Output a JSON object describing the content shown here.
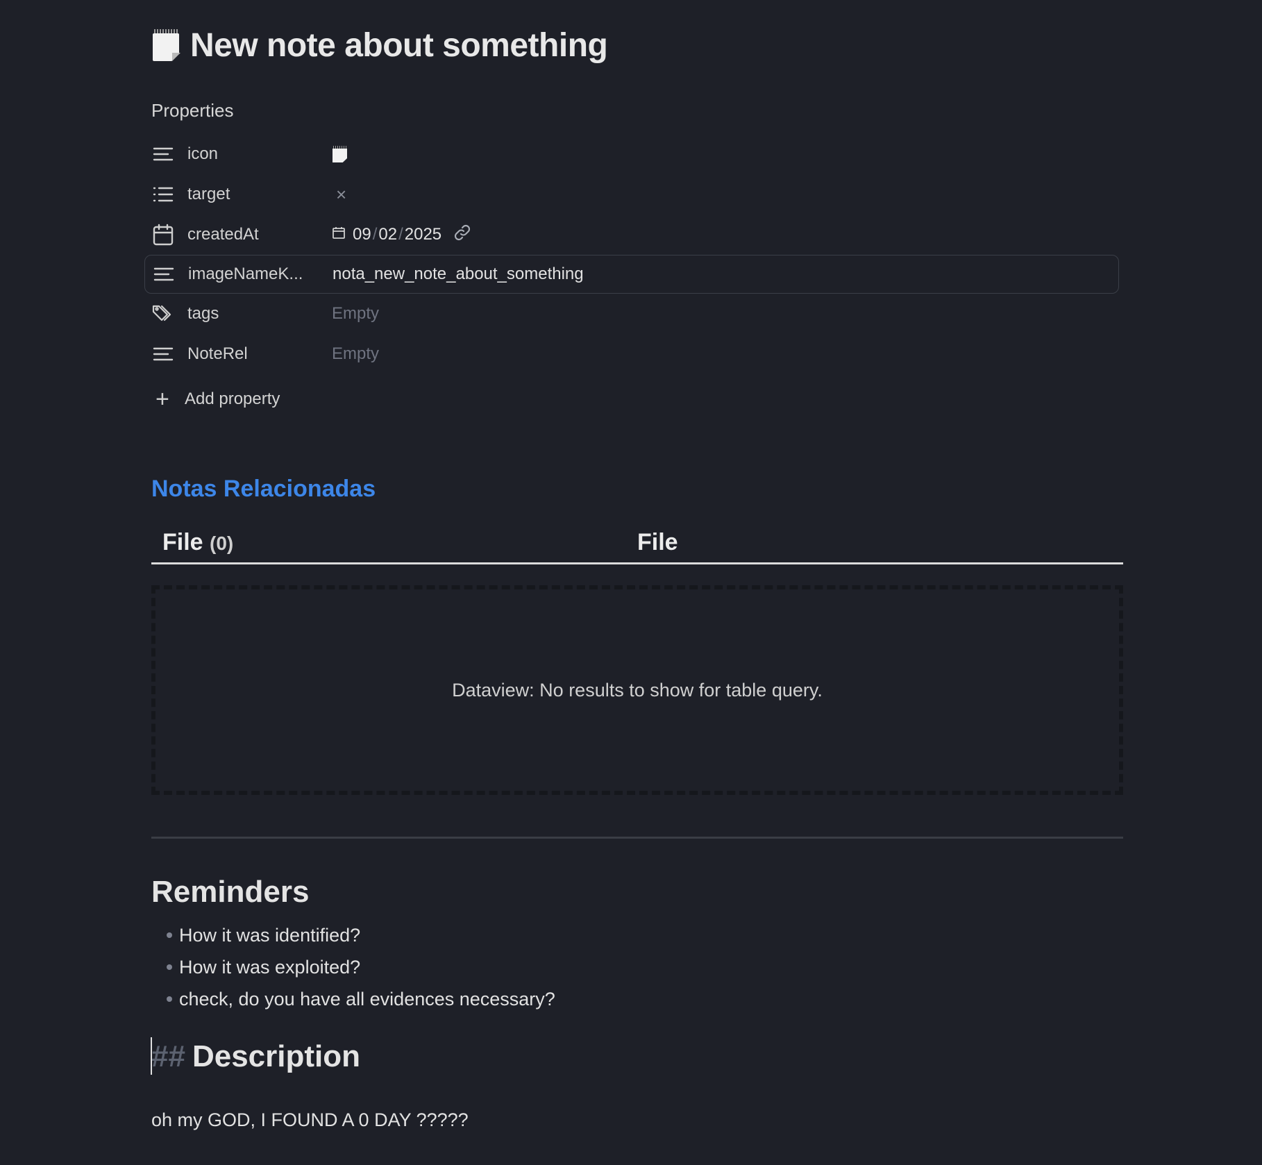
{
  "note": {
    "title": "New note about something",
    "icon": "spiral-notepad-icon"
  },
  "properties": {
    "heading": "Properties",
    "rows": [
      {
        "key": "icon",
        "type_icon": "text-lines-icon",
        "value_icon": "spiral-notepad-icon"
      },
      {
        "key": "target",
        "type_icon": "list-icon",
        "value_icon": "close-icon",
        "value": "×"
      },
      {
        "key": "createdAt",
        "type_icon": "calendar-icon",
        "date": {
          "month": "09",
          "day": "02",
          "year": "2025",
          "sep": "/"
        },
        "value_icon": "link-icon"
      },
      {
        "key": "imageNameK...",
        "type_icon": "text-lines-icon",
        "value": "nota_new_note_about_something"
      },
      {
        "key": "tags",
        "type_icon": "tags-icon",
        "value": "Empty"
      },
      {
        "key": "NoteRel",
        "type_icon": "text-lines-icon",
        "value": "Empty"
      }
    ],
    "add_label": "Add property",
    "add_icon": "plus-icon"
  },
  "related": {
    "heading": "Notas Relacionadas",
    "table": {
      "columns": [
        "File",
        "File"
      ],
      "count": "(0)",
      "empty_message": "Dataview: No results to show for table query."
    }
  },
  "reminders": {
    "heading": "Reminders",
    "items": [
      "How it was identified?",
      "How it was exploited?",
      "check, do you have all evidences necessary?"
    ]
  },
  "description": {
    "marker": "##",
    "heading": "Description",
    "body": "oh my GOD, I FOUND A 0 DAY ?????"
  },
  "colors": {
    "background": "#1e2028",
    "accent_link": "#3d86e8",
    "muted": "#6f7380"
  }
}
